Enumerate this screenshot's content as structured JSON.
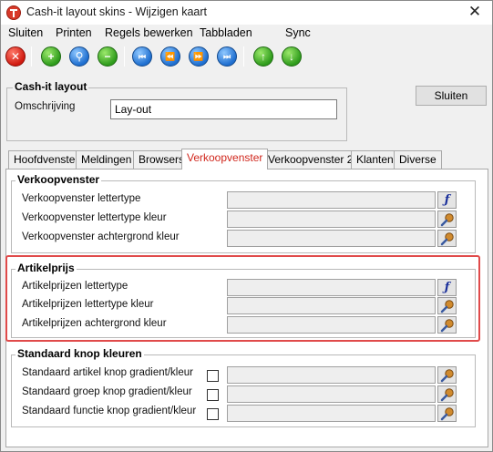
{
  "window": {
    "title": "Cash-it layout skins - Wijzigen kaart",
    "close_glyph": "✕"
  },
  "menu": [
    {
      "label": "Sluiten"
    },
    {
      "label": "Printen"
    },
    {
      "label": "Regels bewerken"
    },
    {
      "label": "Tabbladen"
    },
    {
      "label": "Sync"
    }
  ],
  "toolbar": {
    "buttons": [
      {
        "name": "delete-icon",
        "glyph": "✕",
        "color": "red"
      },
      {
        "name": "add-icon",
        "glyph": "+",
        "color": "green"
      },
      {
        "name": "search-icon",
        "glyph": "⚲",
        "color": "blue"
      },
      {
        "name": "remove-icon",
        "glyph": "−",
        "color": "green"
      },
      {
        "name": "first-record-icon",
        "glyph": "⏮",
        "color": "blue"
      },
      {
        "name": "previous-record-icon",
        "glyph": "⏪",
        "color": "blue"
      },
      {
        "name": "next-record-icon",
        "glyph": "⏩",
        "color": "blue"
      },
      {
        "name": "last-record-icon",
        "glyph": "⏭",
        "color": "blue"
      },
      {
        "name": "move-up-icon",
        "glyph": "↑",
        "color": "green"
      },
      {
        "name": "move-down-icon",
        "glyph": "↓",
        "color": "green"
      }
    ]
  },
  "header_group": {
    "title": "Cash-it layout",
    "description_label": "Omschrijving",
    "description_value": "Lay-out",
    "close_button": "Sluiten"
  },
  "tabs": [
    {
      "label": "Hoofdvenster",
      "active": false
    },
    {
      "label": "Meldingen",
      "active": false
    },
    {
      "label": "Browsers",
      "active": false
    },
    {
      "label": "Verkoopvenster",
      "active": true
    },
    {
      "label": "Verkoopvenster 2",
      "active": false
    },
    {
      "label": "Klanten",
      "active": false
    },
    {
      "label": "Diverse",
      "active": false
    }
  ],
  "verkoopvenster": {
    "title": "Verkoopvenster",
    "rows": [
      {
        "label": "Verkoopvenster lettertype",
        "button": "font-icon"
      },
      {
        "label": "Verkoopvenster lettertype kleur",
        "button": "color-picker-icon"
      },
      {
        "label": "Verkoopvenster achtergrond kleur",
        "button": "color-picker-icon"
      }
    ]
  },
  "artikelprijs": {
    "title": "Artikelprijs",
    "rows": [
      {
        "label": "Artikelprijzen lettertype",
        "button": "font-icon"
      },
      {
        "label": "Artikelprijzen lettertype kleur",
        "button": "color-picker-icon"
      },
      {
        "label": "Artikelprijzen achtergrond kleur",
        "button": "color-picker-icon"
      }
    ]
  },
  "standaard_knop": {
    "title": "Standaard knop kleuren",
    "rows": [
      {
        "label": "Standaard artikel knop gradient/kleur",
        "checked": false
      },
      {
        "label": "Standaard groep knop gradient/kleur",
        "checked": false
      },
      {
        "label": "Standaard functie knop gradient/kleur",
        "checked": false
      }
    ]
  },
  "colors": {
    "active_tab_text": "#d0261c",
    "highlight_border": "#e04a4a",
    "font_icon": "#1a2f9a"
  }
}
